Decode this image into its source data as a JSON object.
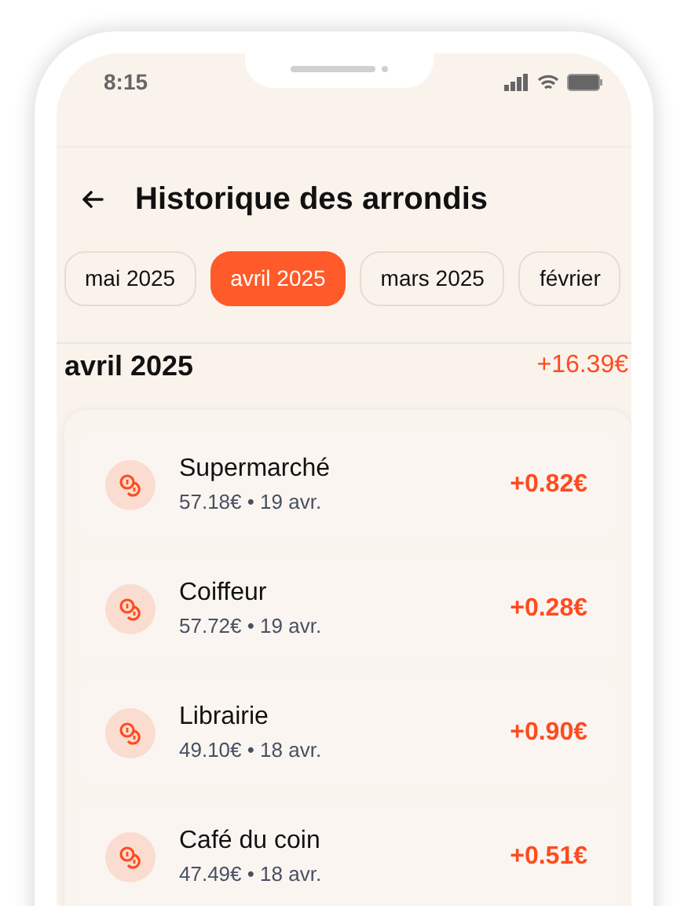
{
  "status_bar": {
    "time": "8:15"
  },
  "header": {
    "title": "Historique des arrondis"
  },
  "tabs": [
    {
      "label": "mai 2025",
      "selected": false
    },
    {
      "label": "avril 2025",
      "selected": true
    },
    {
      "label": "mars 2025",
      "selected": false
    },
    {
      "label": "février",
      "selected": false
    }
  ],
  "month": {
    "label": "avril 2025",
    "total": "+16.39€"
  },
  "transactions": [
    {
      "merchant": "Supermarché",
      "detail": "57.18€ • 19 avr.",
      "roundup": "+0.82€"
    },
    {
      "merchant": "Coiffeur",
      "detail": "57.72€ • 19 avr.",
      "roundup": "+0.28€"
    },
    {
      "merchant": "Librairie",
      "detail": "49.10€ • 18 avr.",
      "roundup": "+0.90€"
    },
    {
      "merchant": "Café du coin",
      "detail": "47.49€ • 18 avr.",
      "roundup": "+0.51€"
    }
  ]
}
